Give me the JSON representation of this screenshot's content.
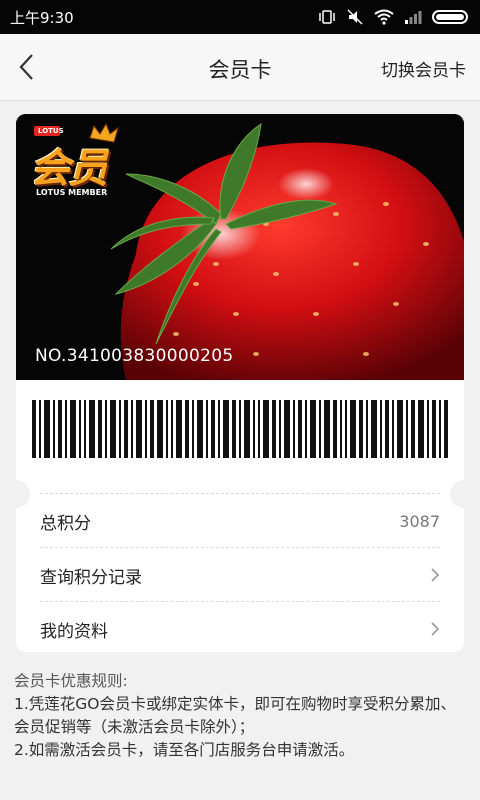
{
  "status_bar": {
    "time": "上午9:30"
  },
  "header": {
    "title": "会员卡",
    "switch_label": "切换会员卡"
  },
  "card": {
    "number": "NO.341003830000205",
    "logo": {
      "brand": "LOTUS",
      "main": "会员",
      "sub": "LOTUS MEMBER"
    },
    "rows": [
      {
        "label": "总积分",
        "value": "3087"
      },
      {
        "label": "查询积分记录"
      },
      {
        "label": "我的资料"
      }
    ]
  },
  "rules": {
    "title": "会员卡优惠规则:",
    "items": [
      "1.凭莲花GO会员卡或绑定实体卡，即可在购物时享受积分累加、会员促销等（未激活会员卡除外）；",
      "2.如需激活会员卡，请至各门店服务台申请激活。"
    ]
  },
  "colors": {
    "status_bar": "#050505",
    "background": "#f1f1f1",
    "card": "#ffffff",
    "logo_orange": "#f08a10"
  },
  "icons": [
    "back-chevron-icon",
    "signal-icon",
    "wifi-icon",
    "mute-icon",
    "battery-icon",
    "chevron-right-icon"
  ]
}
